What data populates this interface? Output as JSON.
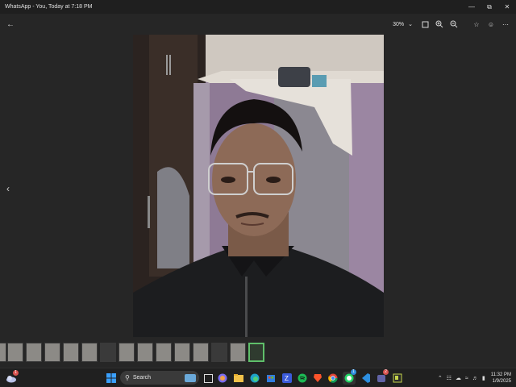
{
  "window": {
    "title": "WhatsApp - You, Today at 7:18 PM",
    "controls": [
      "minimize-icon",
      "restore-icon",
      "close-icon"
    ]
  },
  "toolbar": {
    "zoom_level": "30%",
    "buttons": [
      "fit-to-window-icon",
      "zoom-in-icon",
      "zoom-out-icon",
      "favorite-star-icon",
      "emoji-react-icon",
      "more-options-icon"
    ]
  },
  "viewer": {
    "photo_description_icon": "photo-image"
  },
  "filmstrip": {
    "thumbnail_count": 15,
    "active_index": 14
  },
  "taskbar": {
    "search_placeholder": "Search",
    "apps": [
      "start-icon",
      "task-view-icon",
      "copilot-icon",
      "file-explorer-icon",
      "edge-icon",
      "store-icon",
      "word-icon",
      "spotify-icon",
      "brave-icon",
      "chrome-icon",
      "whatsapp-icon",
      "vscode-icon",
      "teams-icon",
      "notepad-icon"
    ],
    "badges": {
      "weather": "1",
      "whatsapp": "1",
      "teams": "2"
    },
    "time": "11:32 PM",
    "date": "1/9/2025"
  },
  "colors": {
    "background": "#262626",
    "titlebar": "#1f1f1f",
    "taskbar": "#202020",
    "active_thumb_border": "#5fbf6a"
  }
}
